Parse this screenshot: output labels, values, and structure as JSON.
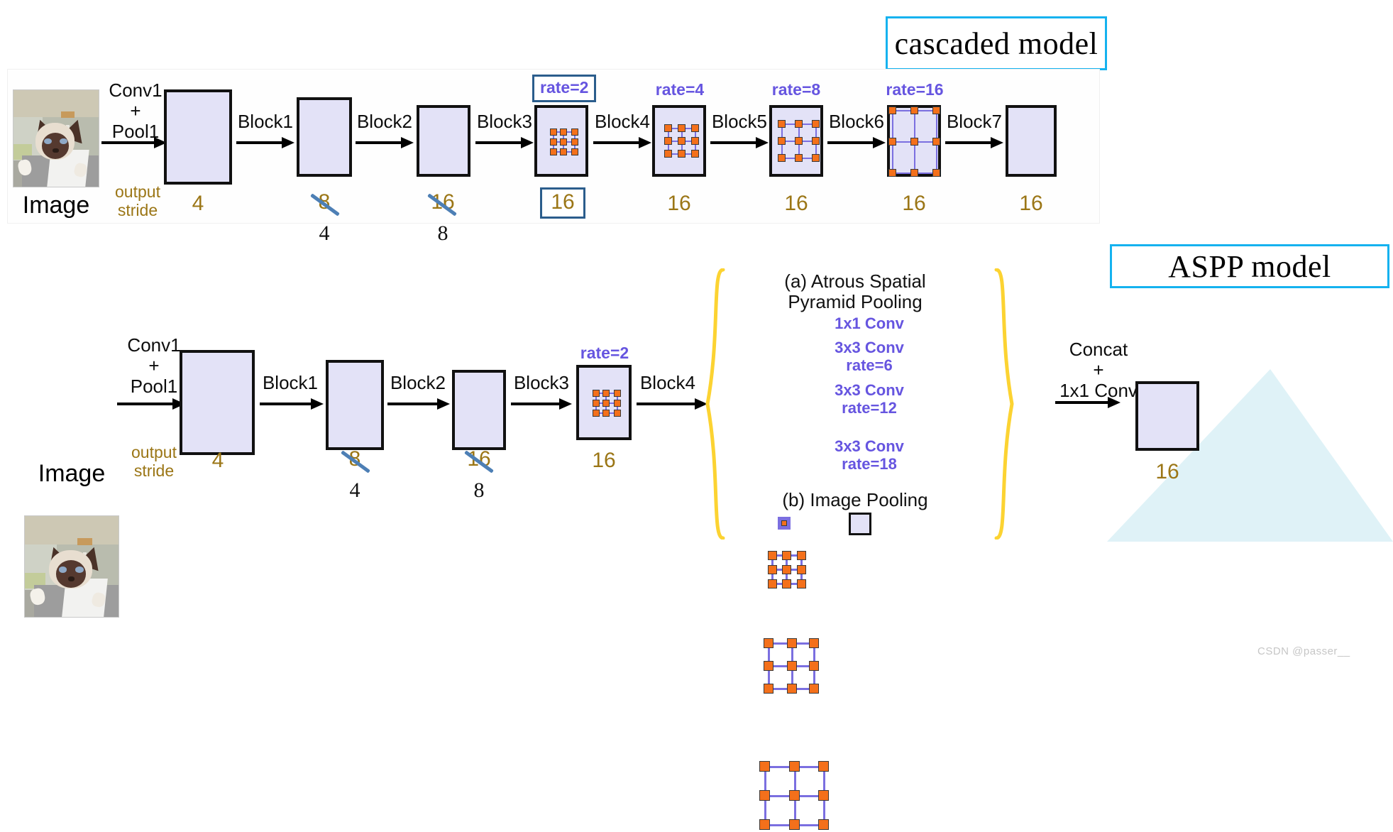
{
  "titles": {
    "cascaded": "cascaded model",
    "aspp": "ASPP model"
  },
  "cascaded": {
    "image_label": "Image",
    "stride_word_line1": "output",
    "stride_word_line2": "stride",
    "arrows": [
      {
        "label_line1": "Conv1",
        "label_line2": "+",
        "label_line3": "Pool1"
      },
      {
        "label_line1": "Block1"
      },
      {
        "label_line1": "Block2"
      },
      {
        "label_line1": "Block3"
      },
      {
        "label_line1": "Block4"
      },
      {
        "label_line1": "Block5"
      },
      {
        "label_line1": "Block6"
      },
      {
        "label_line1": "Block7"
      }
    ],
    "rates": [
      "rate=2",
      "rate=4",
      "rate=8",
      "rate=16"
    ],
    "strides": [
      {
        "value": "4",
        "struck": false,
        "below": "",
        "boxed": false
      },
      {
        "value": "8",
        "struck": true,
        "below": "4",
        "boxed": false
      },
      {
        "value": "16",
        "struck": true,
        "below": "8",
        "boxed": false
      },
      {
        "value": "16",
        "struck": false,
        "below": "",
        "boxed": true
      },
      {
        "value": "16",
        "struck": false,
        "below": "",
        "boxed": false
      },
      {
        "value": "16",
        "struck": false,
        "below": "",
        "boxed": false
      },
      {
        "value": "16",
        "struck": false,
        "below": "",
        "boxed": false
      },
      {
        "value": "16",
        "struck": false,
        "below": "",
        "boxed": false
      }
    ]
  },
  "aspp": {
    "image_label": "Image",
    "stride_word_line1": "output",
    "stride_word_line2": "stride",
    "arrows": [
      {
        "label_line1": "Conv1",
        "label_line2": "+",
        "label_line3": "Pool1"
      },
      {
        "label_line1": "Block1"
      },
      {
        "label_line1": "Block2"
      },
      {
        "label_line1": "Block3"
      },
      {
        "label_line1": "Block4"
      }
    ],
    "rate": "rate=2",
    "strides": [
      {
        "value": "4",
        "struck": false,
        "below": ""
      },
      {
        "value": "8",
        "struck": true,
        "below": "4"
      },
      {
        "value": "16",
        "struck": true,
        "below": "8"
      },
      {
        "value": "16",
        "struck": false,
        "below": ""
      }
    ],
    "panel": {
      "heading_a_line1": "(a) Atrous Spatial",
      "heading_a_line2": "Pyramid Pooling",
      "branches": [
        {
          "line1": "1x1 Conv",
          "line2": ""
        },
        {
          "line1": "3x3 Conv",
          "line2": "rate=6"
        },
        {
          "line1": "3x3 Conv",
          "line2": "rate=12"
        },
        {
          "line1": "3x3 Conv",
          "line2": "rate=18"
        }
      ],
      "heading_b": "(b) Image Pooling"
    },
    "concat": {
      "line1": "Concat",
      "line2": "+",
      "line3": "1x1 Conv"
    },
    "output_stride": "16"
  },
  "watermark": "CSDN @passer__",
  "colors": {
    "title_border": "#15b2ef",
    "block_fill": "#e3e2f7",
    "block_border": "#111111",
    "rate_text": "#6655e0",
    "stride_text": "#9b7616",
    "strike": "#4d7fb5",
    "kernel_dot": "#f4701b",
    "kernel_line": "#7b6fe0",
    "brace": "#fcd332",
    "teal": "#dff2f7",
    "boxed_border": "#2b5d8c"
  }
}
